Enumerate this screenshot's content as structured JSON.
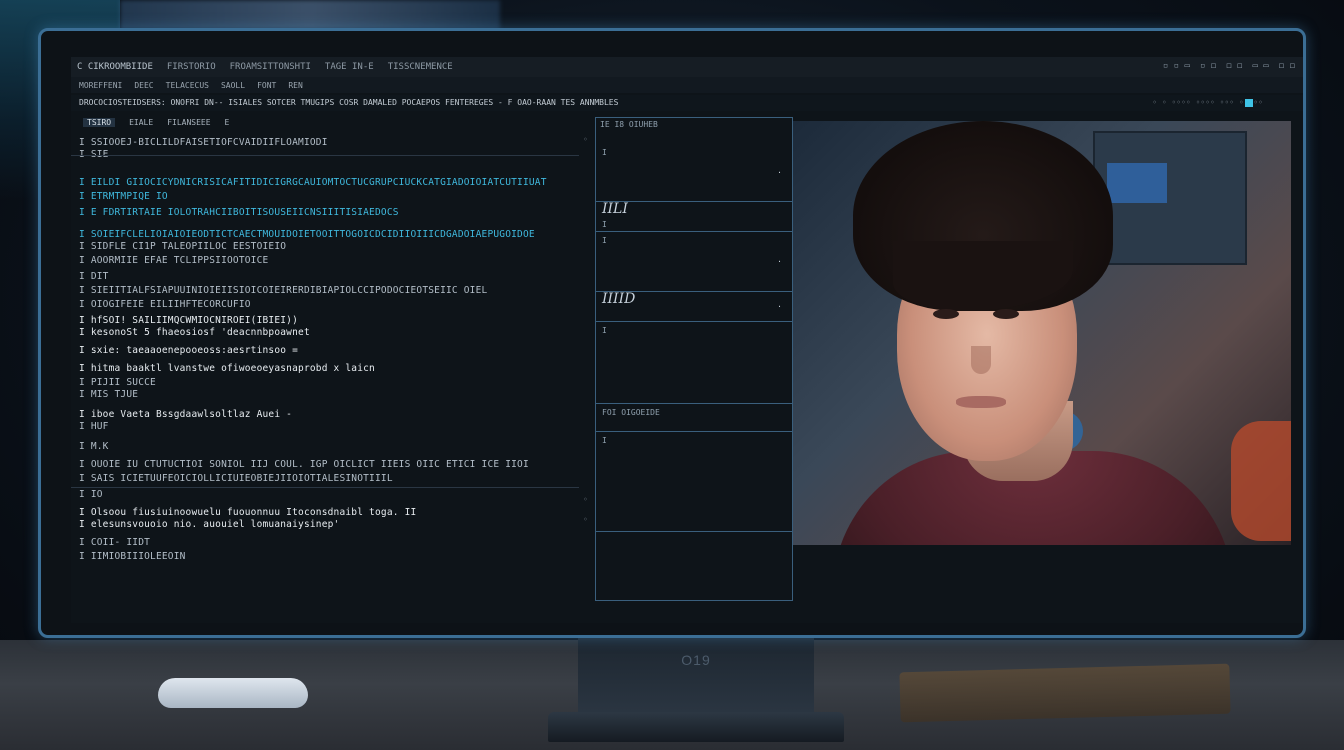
{
  "window": {
    "title": "C CIKROOMBIIDE",
    "menus": [
      "FIRSTORIO",
      "FROAMSITTONSHTI",
      "TAGE IN-E",
      "TISSCNEMENCE"
    ],
    "right_controls": [
      "▫ ▫ ▭",
      "▫ ◻",
      "◻ ◻",
      "▭ ▭",
      "◻ ◻"
    ]
  },
  "menubar": [
    "MOREFFENI",
    "DEEC",
    "TELACECUS",
    "SAOLL",
    "FONT",
    "REN"
  ],
  "toolbar": {
    "text": "DROCOCIOSTEIDSERS: ONOFRI DN-- ISIALES SOTCER TMUGIPS COSR DAMALED POCAEPOS FENTEREGES - F OAO-RAAN TES ANNMBLES",
    "right": "◦ ◦ ◦◦◦◦ ◦◦◦◦ ◦◦◦ ◦◦◦◦◦"
  },
  "editor": {
    "tabs": [
      "TSIRO",
      "EIALE",
      "FILANSEEE",
      "E"
    ],
    "lines": [
      {
        "text": "I SSIOOEJ-BICLILDFAISETIOFCVAIDIIFLOAMIODI",
        "style": "dim"
      },
      {
        "text": "I SIE",
        "style": "dim"
      },
      {
        "text": "I EILDI GIIOCICYDNICRISICAFITIDICIGRGCAUIOMTOCTUCGRUPCIUCKCATGIADOIOIATCUTIIUAT",
        "style": "cyan"
      },
      {
        "text": "I ETRMTMPIQE IO",
        "style": "cyan"
      },
      {
        "text": "I E FDRTIRTAIE IOLOTRAHCIIBOITISOUSEIICNSIIITISIAEDOCS",
        "style": "cyan"
      },
      {
        "text": "I SOIEIFCLELIOIAIOIEODTICTCAECTMOUIDOIETOOITTOGOICDCIDIIOIIICDGADOIAEPUGOIDOE",
        "style": "cyan"
      },
      {
        "text": "I SIDFLE CI1P TALEOPIILOC EESTOIEIO",
        "style": "dim"
      },
      {
        "text": "I AOORMIIE EFAE TCLIPPSIIOOTOICE",
        "style": "dim"
      },
      {
        "text": "I DIT",
        "style": "dim"
      },
      {
        "text": "I SIEIITIALFSIAPUUINIOIEIISIOICOIEIRERDIBIAPIOLCCIPODOCIEOTSEIIC OIEL",
        "style": "dim"
      },
      {
        "text": "I OIOGIFEIE EILIIHFTECORCUFIO",
        "style": "dim"
      },
      {
        "text": "I hfSOI! SAILIIMQCWMIOCNIROEI(IBIEI))",
        "style": "white"
      },
      {
        "text": "I kesonoSt 5 fhaeosiosf 'deacnnbpoawnet",
        "style": "white"
      },
      {
        "text": "I sxie: taeaaoenepooeoss:aesrtinsoo =",
        "style": "white"
      },
      {
        "text": "I hitma baaktl lvanstwe ofiwoeoeyasnaprobd x laicn",
        "style": "white"
      },
      {
        "text": "I PIJII SUCCE",
        "style": "dim"
      },
      {
        "text": "I MIS TJUE",
        "style": "dim"
      },
      {
        "text": "I iboe Vaeta Bssgdaawlsoltlaz Auei -",
        "style": "white"
      },
      {
        "text": "I HUF",
        "style": "dim"
      },
      {
        "text": "I M.K",
        "style": "dim"
      },
      {
        "text": "I OUOIE IU CTUTUCTIOI SONIOL IIJ COUL. IGP OICLICT IIEIS OIIC ETICI ICE IIOI",
        "style": "dim"
      },
      {
        "text": "I SAIS ICIETUUFEOICIOLLICIUIEOBIEJIIOIOTIALESINOTIIIL",
        "style": "dim"
      },
      {
        "text": "I IO",
        "style": "dim"
      },
      {
        "text": "I Olsoou fiusiuinoowuelu fuouonnuu Itoconsdnaibl toga. II",
        "style": "white"
      },
      {
        "text": "I elesunsvouoio nio. auouiel lomuanaiysinep'",
        "style": "white"
      },
      {
        "text": "I COII- IIDT",
        "style": "dim"
      },
      {
        "text": "I IIMIOBIIIOLEEOIN",
        "style": "dim"
      }
    ]
  },
  "watch": {
    "header": "IE I8   OIUHEB",
    "rows": [
      {
        "label": "",
        "small": "I",
        "dot": "·"
      },
      {
        "label": "IILI",
        "small": "I",
        "dot": ""
      },
      {
        "label": "",
        "small": "I",
        "dot": "·"
      },
      {
        "label": "IIIID",
        "small": "",
        "dot": "·"
      },
      {
        "label": "",
        "small": "I",
        "dot": ""
      },
      {
        "label": "",
        "small": "FOI OIGOEIDE",
        "dot": ""
      },
      {
        "label": "",
        "small": "I",
        "dot": ""
      }
    ]
  },
  "video": {
    "caption": ""
  },
  "stand": {
    "label": "O19"
  },
  "colors": {
    "accent": "#3fb8dd",
    "border": "#3b6e95",
    "bg": "#0e1419"
  }
}
